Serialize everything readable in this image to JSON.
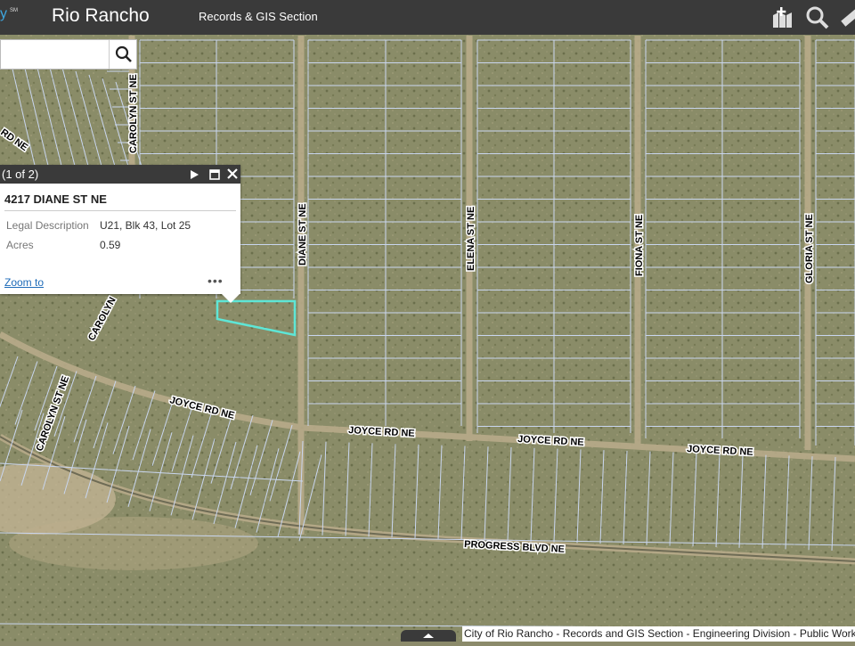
{
  "header": {
    "brand_mark": "y",
    "brand_sm": "SM",
    "title": "Rio Rancho",
    "subtitle": "Records & GIS Section"
  },
  "search": {
    "value": "",
    "placeholder": ""
  },
  "popup": {
    "count": "(1 of 2)",
    "title": "4217 DIANE ST NE",
    "attributes": [
      {
        "label": "Legal Description",
        "value": "U21, Blk 43, Lot 25"
      },
      {
        "label": "Acres",
        "value": "0.59"
      }
    ],
    "zoom_label": "Zoom to",
    "more_label": "•••"
  },
  "map": {
    "roads": {
      "carolyn_n": "CAROLYN ST NE",
      "rd_ne": "RD NE",
      "diane": "DIANE ST NE",
      "elena": "ELENA ST NE",
      "fiona": "FIONA ST NE",
      "gloria": "GLORIA ST NE",
      "carolyn_mid": "CAROLYN",
      "carolyn_s": "CAROLYN ST NE",
      "joyce_1": "JOYCE RD NE",
      "joyce_2": "JOYCE RD NE",
      "joyce_3": "JOYCE RD NE",
      "joyce_4": "JOYCE RD NE",
      "progress": "PROGRESS BLVD NE"
    },
    "highlight_color": "#5ee6d6",
    "parcel_line_color": "#c9d6ef"
  },
  "attribution": "City of Rio Rancho - Records and GIS Section - Engineering Division - Public Works"
}
